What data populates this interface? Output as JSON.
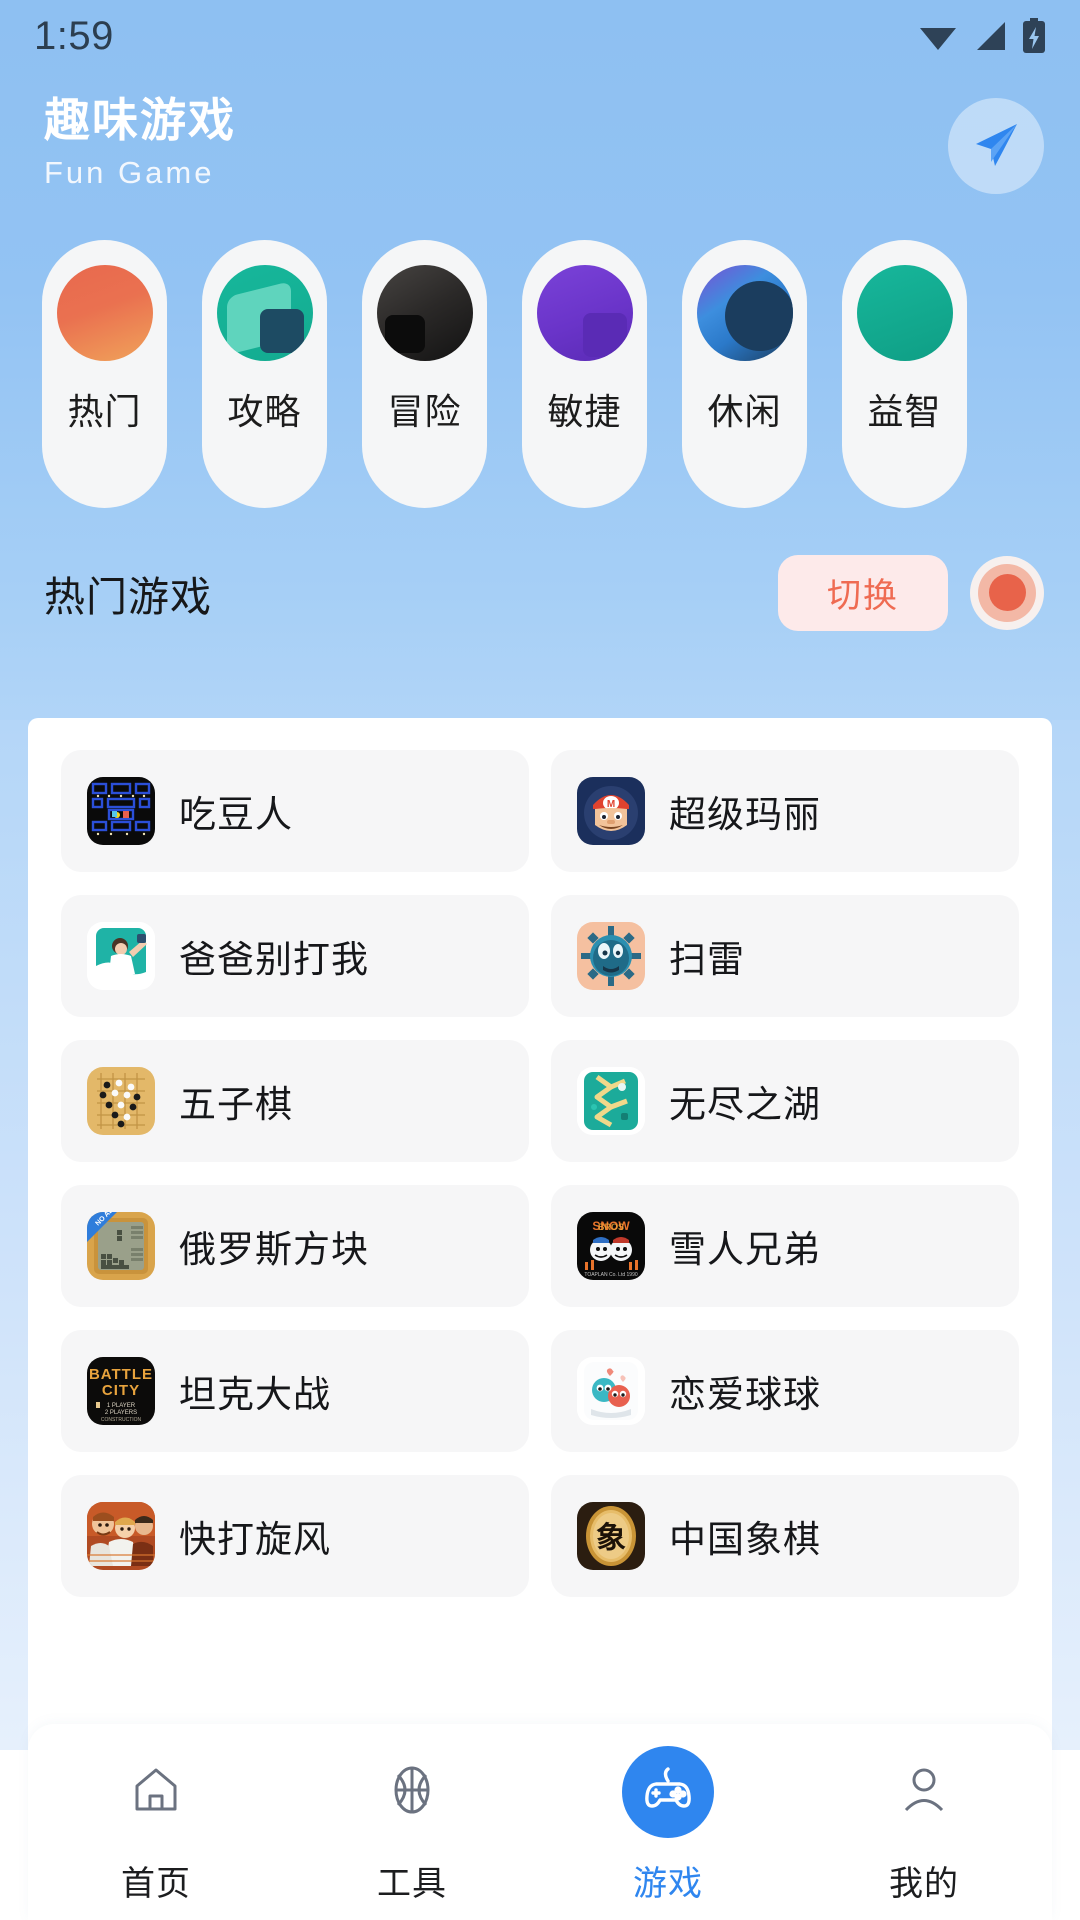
{
  "status_bar": {
    "time": "1:59",
    "icons": [
      "wifi-icon",
      "signal-icon",
      "battery-charging-icon"
    ]
  },
  "header": {
    "title": "趣味游戏",
    "subtitle": "Fun  Game",
    "action_icon": "send-plane-icon"
  },
  "categories": [
    {
      "label": "热门",
      "icon": "category-icon-hot",
      "color_a": "#e8694e",
      "color_b": "#f1a04f",
      "shape": "#f0a35a",
      "shape2": "#e3583f"
    },
    {
      "label": "攻略",
      "icon": "category-icon-guide",
      "color_a": "#16b79b",
      "color_b": "#14a98f",
      "shape": "#5fd4bd",
      "shape2": "#1d4b63"
    },
    {
      "label": "冒险",
      "icon": "category-icon-adventure",
      "color_a": "#3c3a39",
      "color_b": "#1a1a1a",
      "shape": "#4a4745",
      "shape2": "#0d0d0d"
    },
    {
      "label": "敏捷",
      "icon": "category-icon-agility",
      "color_a": "#6a34c9",
      "color_b": "#5a2bb5",
      "shape": "#8450e0",
      "shape2": "#4d1fa8"
    },
    {
      "label": "休闲",
      "icon": "category-icon-casual",
      "color_a": "#2e74c4",
      "color_b": "#1c3f63",
      "shape": "#3d8ede",
      "shape2": "#1b3d5e"
    },
    {
      "label": "益智",
      "icon": "category-icon-puzzle",
      "color_a": "#17b79b",
      "color_b": "#0f9e85",
      "shape": "#4fd0b8",
      "shape2": "#138f79"
    }
  ],
  "section": {
    "title": "热门游戏",
    "switch_label": "切换",
    "record_icon": "record-dot-icon",
    "switch_color": "#ef6b52"
  },
  "games": [
    {
      "name": "吃豆人",
      "icon": "pacman-icon"
    },
    {
      "name": "超级玛丽",
      "icon": "mario-icon"
    },
    {
      "name": "爸爸别打我",
      "icon": "dad-dont-hit-me-icon"
    },
    {
      "name": "扫雷",
      "icon": "minesweeper-icon"
    },
    {
      "name": "五子棋",
      "icon": "gomoku-icon"
    },
    {
      "name": "无尽之湖",
      "icon": "endless-lake-icon"
    },
    {
      "name": "俄罗斯方块",
      "icon": "tetris-icon"
    },
    {
      "name": "雪人兄弟",
      "icon": "snow-bros-icon"
    },
    {
      "name": "坦克大战",
      "icon": "battle-city-icon"
    },
    {
      "name": "恋爱球球",
      "icon": "love-balls-icon"
    },
    {
      "name": "快打旋风",
      "icon": "final-fight-icon"
    },
    {
      "name": "中国象棋",
      "icon": "chinese-chess-icon"
    }
  ],
  "bottom_nav": {
    "active_color": "#2f86ef",
    "items": [
      {
        "label": "首页",
        "icon": "home-icon",
        "active": false
      },
      {
        "label": "工具",
        "icon": "basketball-icon",
        "active": false
      },
      {
        "label": "游戏",
        "icon": "gamepad-icon",
        "active": true
      },
      {
        "label": "我的",
        "icon": "person-icon",
        "active": false
      }
    ]
  }
}
